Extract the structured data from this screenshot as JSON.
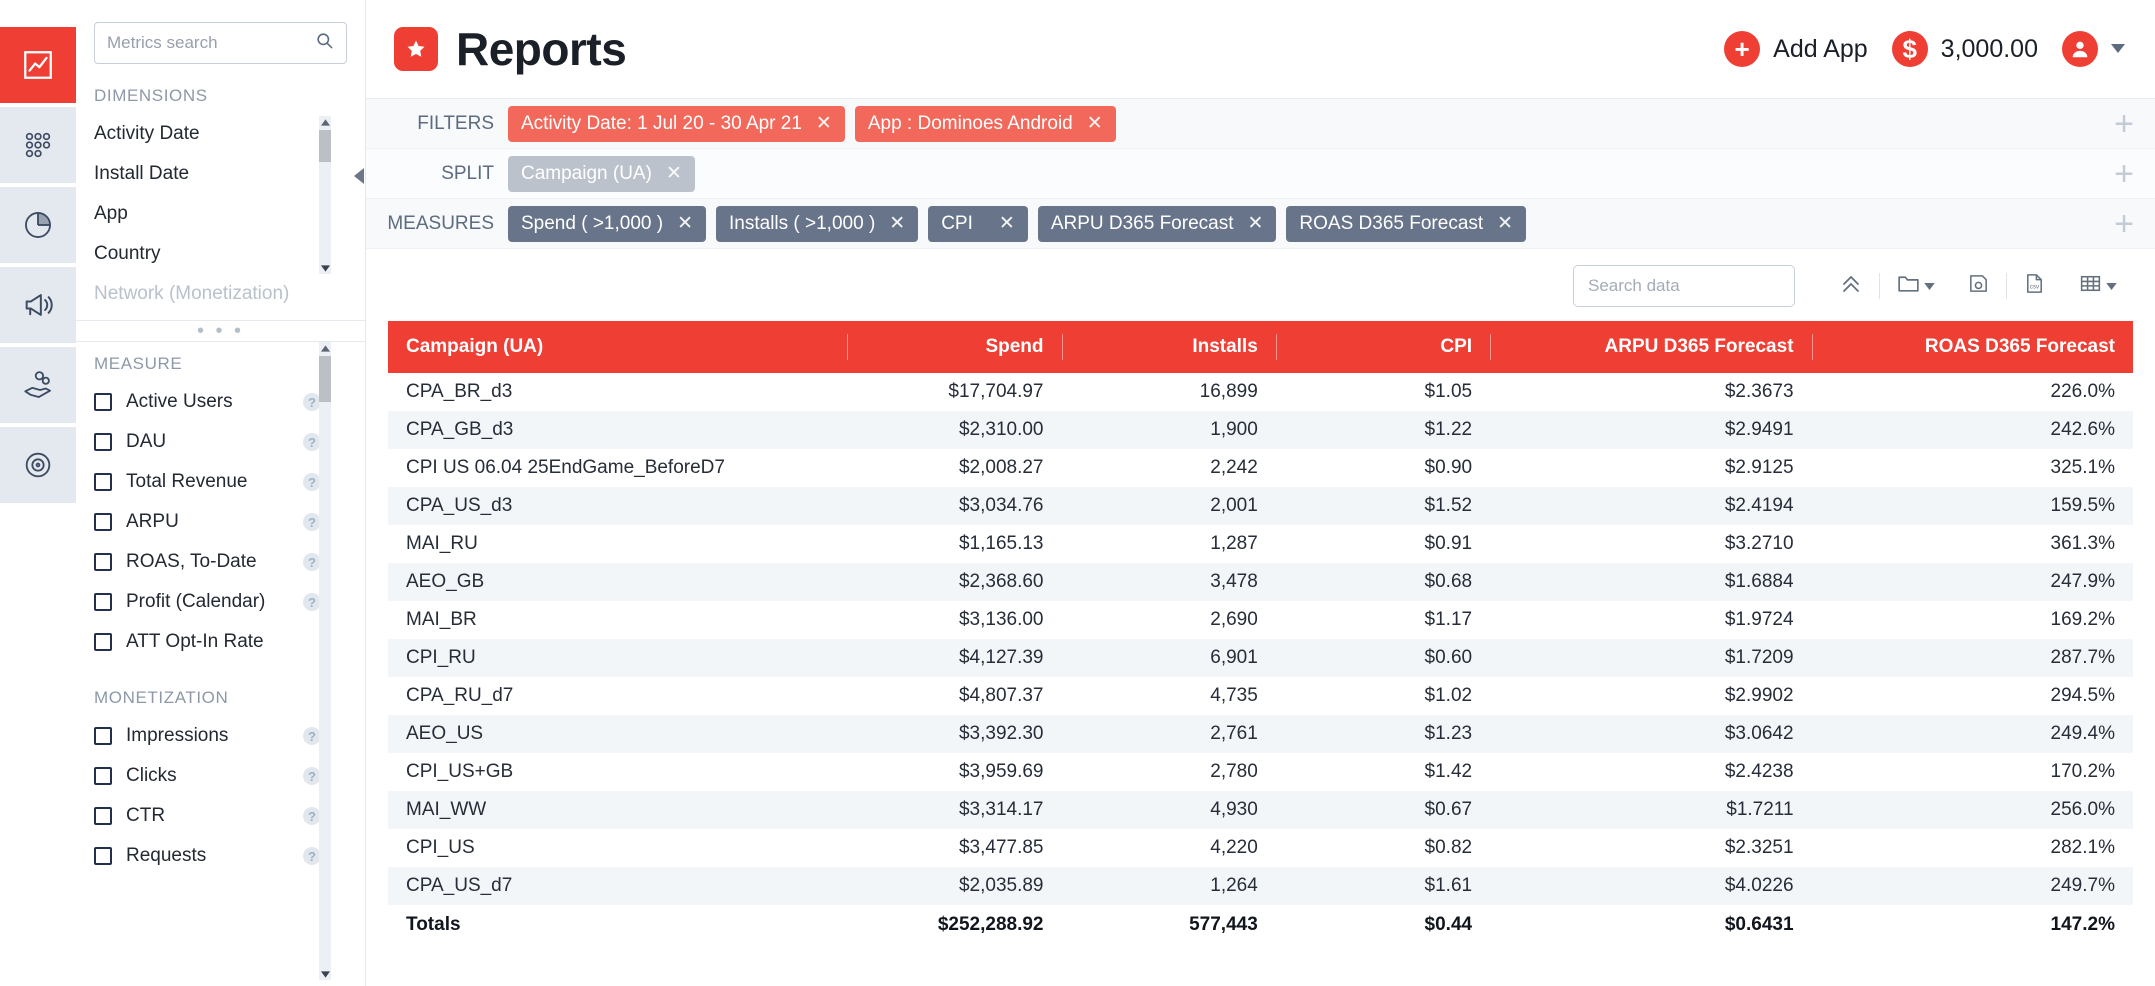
{
  "colors": {
    "accent": "#ef3e33",
    "filter_chip": "#f2695c",
    "split_chip": "#bcc2cb",
    "measure_chip": "#68748a",
    "rail_bg": "#e4e9ef"
  },
  "rail": {
    "items": [
      {
        "name": "reports-chart-icon",
        "label": "Reports",
        "active": true
      },
      {
        "name": "cohorts-dots-icon",
        "label": "Cohorts",
        "active": false
      },
      {
        "name": "pie-chart-icon",
        "label": "Breakdown",
        "active": false
      },
      {
        "name": "megaphone-icon",
        "label": "Campaigns",
        "active": false
      },
      {
        "name": "hand-coins-icon",
        "label": "Monetization",
        "active": false
      },
      {
        "name": "target-icon",
        "label": "Goals",
        "active": false
      }
    ]
  },
  "sidebar": {
    "search": {
      "placeholder": "Metrics search",
      "value": ""
    },
    "dimensions": {
      "label": "DIMENSIONS",
      "items": [
        {
          "label": "Activity Date",
          "muted": false
        },
        {
          "label": "Install Date",
          "muted": false
        },
        {
          "label": "App",
          "muted": false
        },
        {
          "label": "Country",
          "muted": false
        },
        {
          "label": "Network (Monetization)",
          "muted": true
        }
      ]
    },
    "divider_dots": "• • •",
    "measure": {
      "label": "MEASURE",
      "items": [
        {
          "label": "Active Users",
          "checked": false,
          "help": true
        },
        {
          "label": "DAU",
          "checked": false,
          "help": true
        },
        {
          "label": "Total Revenue",
          "checked": false,
          "help": true
        },
        {
          "label": "ARPU",
          "checked": false,
          "help": true
        },
        {
          "label": "ROAS, To-Date",
          "checked": false,
          "help": true
        },
        {
          "label": "Profit (Calendar)",
          "checked": false,
          "help": true
        },
        {
          "label": "ATT Opt-In Rate",
          "checked": false,
          "help": false
        }
      ]
    },
    "monetization": {
      "label": "MONETIZATION",
      "items": [
        {
          "label": "Impressions",
          "checked": false,
          "help": true
        },
        {
          "label": "Clicks",
          "checked": false,
          "help": true
        },
        {
          "label": "CTR",
          "checked": false,
          "help": true
        },
        {
          "label": "Requests",
          "checked": false,
          "help": true
        }
      ]
    }
  },
  "header": {
    "title": "Reports",
    "logo_icon": "star-badge-icon",
    "add_app": {
      "label": "Add App",
      "icon": "plus-circle-icon"
    },
    "balance": {
      "label": "3,000.00",
      "icon": "dollar-circle-icon"
    },
    "avatar_icon": "user-avatar-icon",
    "avatar_caret": "▾"
  },
  "query": {
    "rows": [
      {
        "label": "FILTERS",
        "kind": "filter",
        "chips": [
          {
            "label": "Activity Date: 1 Jul 20 - 30 Apr 21",
            "remove": "✕"
          },
          {
            "label": "App : Dominoes Android",
            "remove": "✕"
          }
        ],
        "add": "+"
      },
      {
        "label": "SPLIT",
        "kind": "split",
        "chips": [
          {
            "label": "Campaign (UA)",
            "remove": "✕"
          }
        ],
        "add": "+"
      },
      {
        "label": "MEASURES",
        "kind": "measure",
        "chips": [
          {
            "label": "Spend ( >1,000 )",
            "remove": "✕"
          },
          {
            "label": "Installs ( >1,000 )",
            "remove": "✕"
          },
          {
            "label": "CPI",
            "remove": "✕"
          },
          {
            "label": "ARPU D365 Forecast",
            "remove": "✕"
          },
          {
            "label": "ROAS D365 Forecast",
            "remove": "✕"
          }
        ],
        "add": "+"
      }
    ]
  },
  "toolbar": {
    "search": {
      "placeholder": "Search data",
      "value": ""
    },
    "buttons": [
      {
        "name": "collapse-all-icon",
        "caret": false
      },
      {
        "name": "folder-icon",
        "caret": true
      },
      {
        "name": "save-disk-icon",
        "caret": false
      },
      {
        "name": "csv-export-icon",
        "caret": false
      },
      {
        "name": "table-view-icon",
        "caret": true
      }
    ]
  },
  "table": {
    "columns": [
      "Campaign (UA)",
      "Spend",
      "Installs",
      "CPI",
      "ARPU D365 Forecast",
      "ROAS D365 Forecast"
    ],
    "rows": [
      [
        "CPA_BR_d3",
        "$17,704.97",
        "16,899",
        "$1.05",
        "$2.3673",
        "226.0%"
      ],
      [
        "CPA_GB_d3",
        "$2,310.00",
        "1,900",
        "$1.22",
        "$2.9491",
        "242.6%"
      ],
      [
        "CPI US 06.04 25EndGame_BeforeD7",
        "$2,008.27",
        "2,242",
        "$0.90",
        "$2.9125",
        "325.1%"
      ],
      [
        "CPA_US_d3",
        "$3,034.76",
        "2,001",
        "$1.52",
        "$2.4194",
        "159.5%"
      ],
      [
        "MAI_RU",
        "$1,165.13",
        "1,287",
        "$0.91",
        "$3.2710",
        "361.3%"
      ],
      [
        "AEO_GB",
        "$2,368.60",
        "3,478",
        "$0.68",
        "$1.6884",
        "247.9%"
      ],
      [
        "MAI_BR",
        "$3,136.00",
        "2,690",
        "$1.17",
        "$1.9724",
        "169.2%"
      ],
      [
        "CPI_RU",
        "$4,127.39",
        "6,901",
        "$0.60",
        "$1.7209",
        "287.7%"
      ],
      [
        "CPA_RU_d7",
        "$4,807.37",
        "4,735",
        "$1.02",
        "$2.9902",
        "294.5%"
      ],
      [
        "AEO_US",
        "$3,392.30",
        "2,761",
        "$1.23",
        "$3.0642",
        "249.4%"
      ],
      [
        "CPI_US+GB",
        "$3,959.69",
        "2,780",
        "$1.42",
        "$2.4238",
        "170.2%"
      ],
      [
        "MAI_WW",
        "$3,314.17",
        "4,930",
        "$0.67",
        "$1.7211",
        "256.0%"
      ],
      [
        "CPI_US",
        "$3,477.85",
        "4,220",
        "$0.82",
        "$2.3251",
        "282.1%"
      ],
      [
        "CPA_US_d7",
        "$2,035.89",
        "1,264",
        "$1.61",
        "$4.0226",
        "249.7%"
      ]
    ],
    "totals": [
      "Totals",
      "$252,288.92",
      "577,443",
      "$0.44",
      "$0.6431",
      "147.2%"
    ]
  }
}
